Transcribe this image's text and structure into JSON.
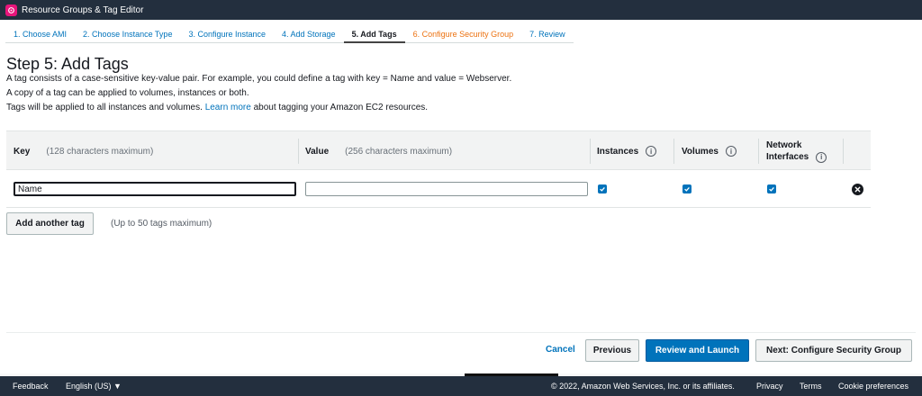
{
  "app": {
    "title": "Resource Groups & Tag Editor",
    "icon": "resource-groups-icon"
  },
  "steps": [
    {
      "label": "1. Choose AMI"
    },
    {
      "label": "2. Choose Instance Type"
    },
    {
      "label": "3. Configure Instance"
    },
    {
      "label": "4. Add Storage"
    },
    {
      "label": "5. Add Tags"
    },
    {
      "label": "6. Configure Security Group"
    },
    {
      "label": "7. Review"
    }
  ],
  "page": {
    "title": "Step 5: Add Tags",
    "line1": "A tag consists of a case-sensitive key-value pair. For example, you could define a tag with key = Name and value = Webserver.",
    "line2": "A copy of a tag can be applied to volumes, instances or both.",
    "line3_pre": "Tags will be applied to all instances and volumes.",
    "line3_link": "Learn more",
    "line3_post": "about tagging your Amazon EC2 resources."
  },
  "table": {
    "headers": {
      "key": "Key",
      "key_hint": "(128 characters maximum)",
      "value": "Value",
      "value_hint": "(256 characters maximum)",
      "instances": "Instances",
      "volumes": "Volumes",
      "network_line1": "Network",
      "network_line2": "Interfaces",
      "info": "i"
    },
    "rows": [
      {
        "key": "Name",
        "value": "",
        "instances": true,
        "volumes": true,
        "network_interfaces": true
      }
    ]
  },
  "actions": {
    "add_tag": "Add another tag",
    "add_tag_hint": "(Up to 50 tags maximum)",
    "cancel": "Cancel",
    "previous": "Previous",
    "review_launch": "Review and Launch",
    "next": "Next: Configure Security Group"
  },
  "footer": {
    "feedback": "Feedback",
    "language": "English (US) ▼",
    "copyright": "© 2022, Amazon Web Services, Inc. or its affiliates.",
    "privacy": "Privacy",
    "terms": "Terms",
    "cookies": "Cookie preferences"
  },
  "colors": {
    "nav_bg": "#232f3e",
    "link": "#0073bb",
    "primary": "#0073bb",
    "warning_tab": "#ec7211",
    "brand_icon": "#e7157b"
  }
}
